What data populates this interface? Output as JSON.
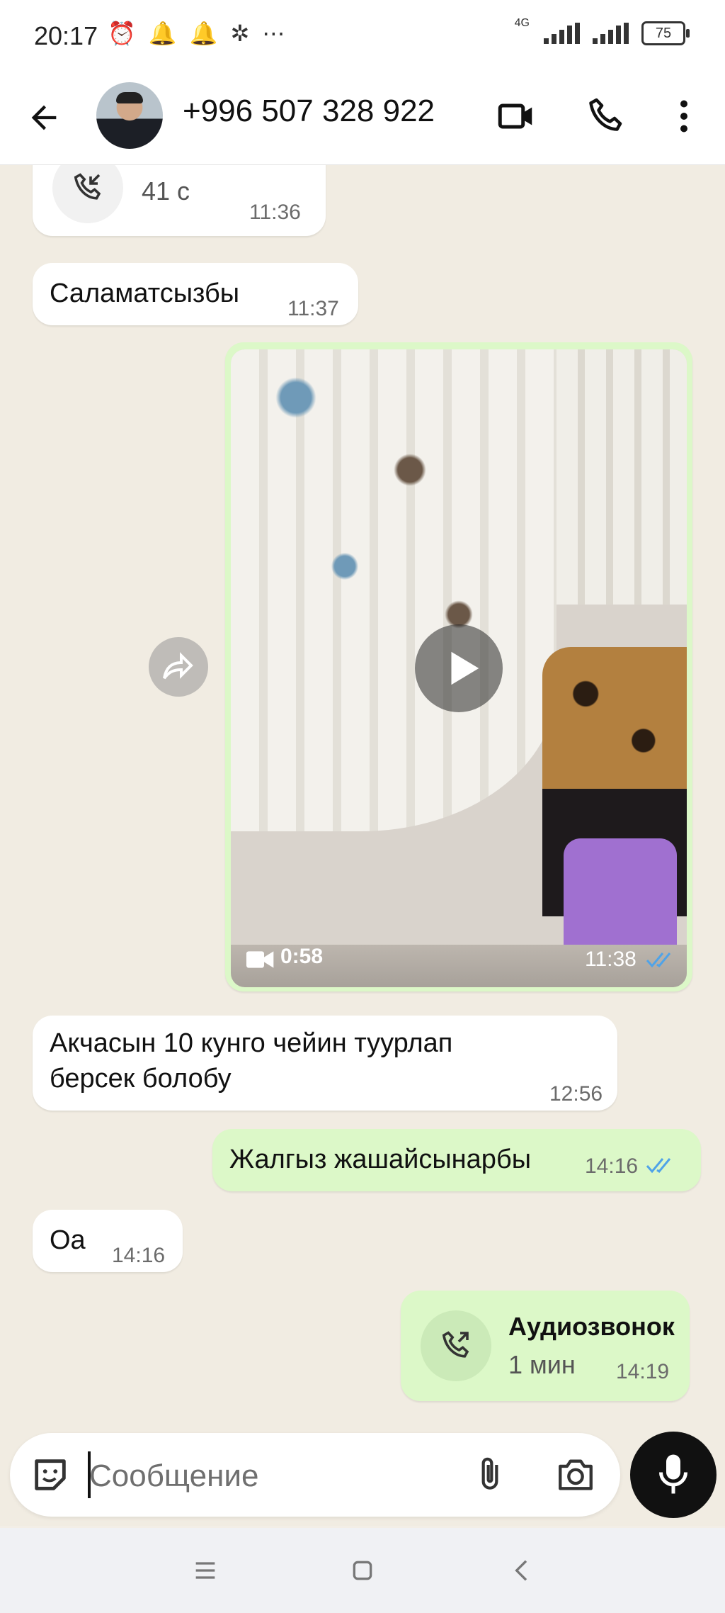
{
  "status_bar": {
    "time": "20:17",
    "network_label": "4G",
    "battery": "75"
  },
  "header": {
    "contact_name": "+996 507 328 922",
    "icons": [
      "back-arrow-icon",
      "video-call-icon",
      "phone-icon",
      "more-vert-icon"
    ]
  },
  "messages": {
    "call_in": {
      "duration": "41 с",
      "time": "11:36"
    },
    "greeting": {
      "text": "Саламатсызбы",
      "time": "11:37"
    },
    "video": {
      "duration": "0:58",
      "time": "11:38"
    },
    "money": {
      "line1": "Акчасын 10 кунго чейин туурлап",
      "line2": "берсек болобу",
      "time": "12:56"
    },
    "alone": {
      "text": "Жалгыз жашайсынарбы",
      "time": "14:16"
    },
    "yes": {
      "text": "Оа",
      "time": "14:16"
    },
    "call_out": {
      "title": "Аудиозвонок",
      "duration": "1 мин",
      "time": "14:19"
    }
  },
  "composer": {
    "placeholder": "Сообщение"
  },
  "colors": {
    "outgoing_bubble": "#dcf8c8",
    "incoming_bubble": "#ffffff",
    "read_ticks": "#4fa3e8"
  }
}
